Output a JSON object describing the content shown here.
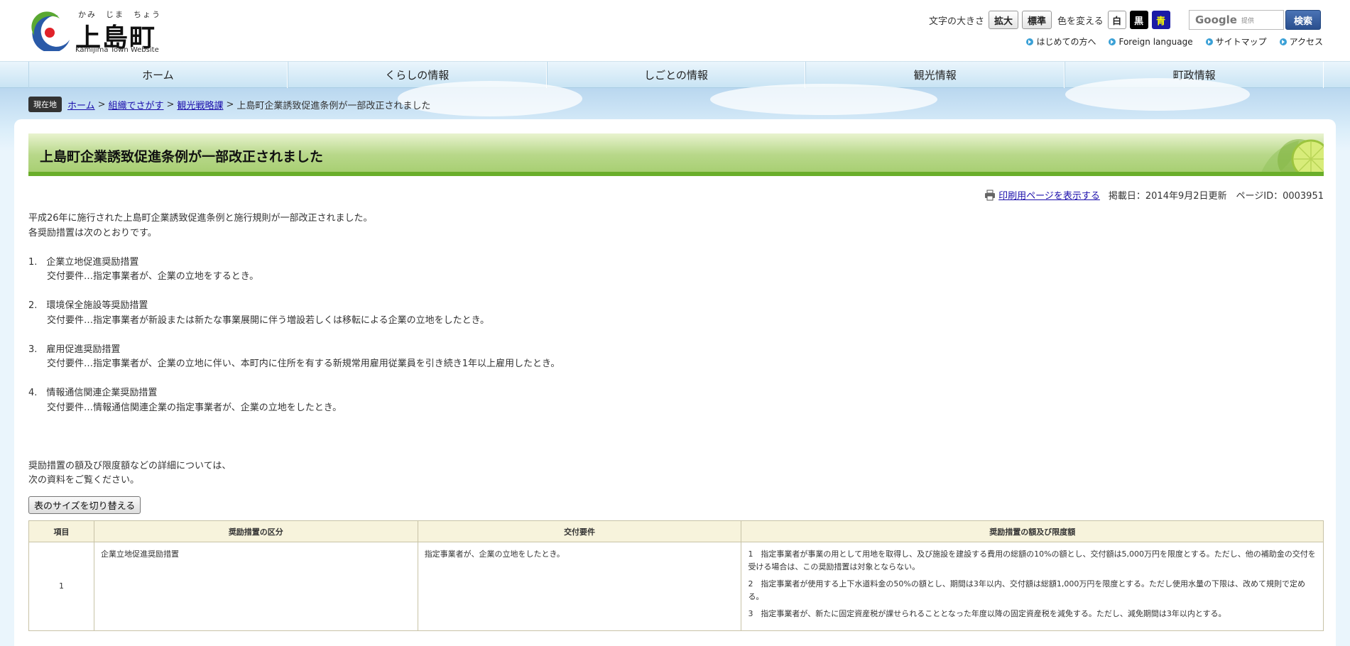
{
  "logo": {
    "ruby": "かみ　じま　ちょう",
    "name": "上島町",
    "subtitle": "Kamijima Town Website"
  },
  "utility": {
    "font_size_label": "文字の大きさ",
    "font_size_buttons": [
      "拡大",
      "標準"
    ],
    "color_label": "色を変える",
    "color_buttons": [
      "白",
      "黒",
      "青"
    ],
    "search_brand": "Google",
    "search_brand_sub": "提供",
    "search_button": "検索"
  },
  "sublinks": [
    "はじめての方へ",
    "Foreign language",
    "サイトマップ",
    "アクセス"
  ],
  "gnav": [
    "ホーム",
    "くらしの情報",
    "しごとの情報",
    "観光情報",
    "町政情報"
  ],
  "breadcrumb": {
    "label": "現在地",
    "links": [
      "ホーム",
      "組織でさがす",
      "観光戦略課"
    ],
    "current": "上島町企業誘致促進条例が一部改正されました"
  },
  "page": {
    "title": "上島町企業誘致促進条例が一部改正されました",
    "print_link": "印刷用ページを表示する",
    "meta": "掲載日：2014年9月2日更新　ページID：0003951",
    "body": "平成26年に施行された上島町企業誘致促進条例と施行規則が一部改正されました。\n各奨励措置は次のとおりです。\n\n1.　企業立地促進奨励措置\n　　交付要件…指定事業者が、企業の立地をするとき。\n\n2.　環境保全施設等奨励措置\n　　交付要件…指定事業者が新設または新たな事業展開に伴う増設若しくは移転による企業の立地をしたとき。\n\n3.　雇用促進奨励措置\n　　交付要件…指定事業者が、企業の立地に伴い、本町内に住所を有する新規常用雇用従業員を引き続き1年以上雇用したとき。\n\n4.　情報通信関連企業奨励措置\n　　交付要件…情報通信関連企業の指定事業者が、企業の立地をしたとき。\n\n\n\n奨励措置の額及び限度額などの詳細については、\n次の資料をご覧ください。",
    "toggle_button": "表のサイズを切り替える"
  },
  "table": {
    "headers": [
      "項目",
      "奨励措置の区分",
      "交付要件",
      "奨励措置の額及び限度額"
    ],
    "rows": [
      {
        "num": "1",
        "category": "企業立地促進奨励措置",
        "requirement": "指定事業者が、企業の立地をしたとき。",
        "amounts": [
          "1　指定事業者が事業の用として用地を取得し、及び施設を建設する費用の総額の10%の額とし、交付額は5,000万円を限度とする。ただし、他の補助金の交付を受ける場合は、この奨励措置は対象とならない。",
          "2　指定事業者が使用する上下水道料金の50%の額とし、期間は3年以内、交付額は総額1,000万円を限度とする。ただし使用水量の下限は、改めて規則で定める。",
          "3　指定事業者が、新たに固定資産税が課せられることとなった年度以降の固定資産税を減免する。ただし、減免期間は3年以内とする。"
        ]
      }
    ]
  }
}
